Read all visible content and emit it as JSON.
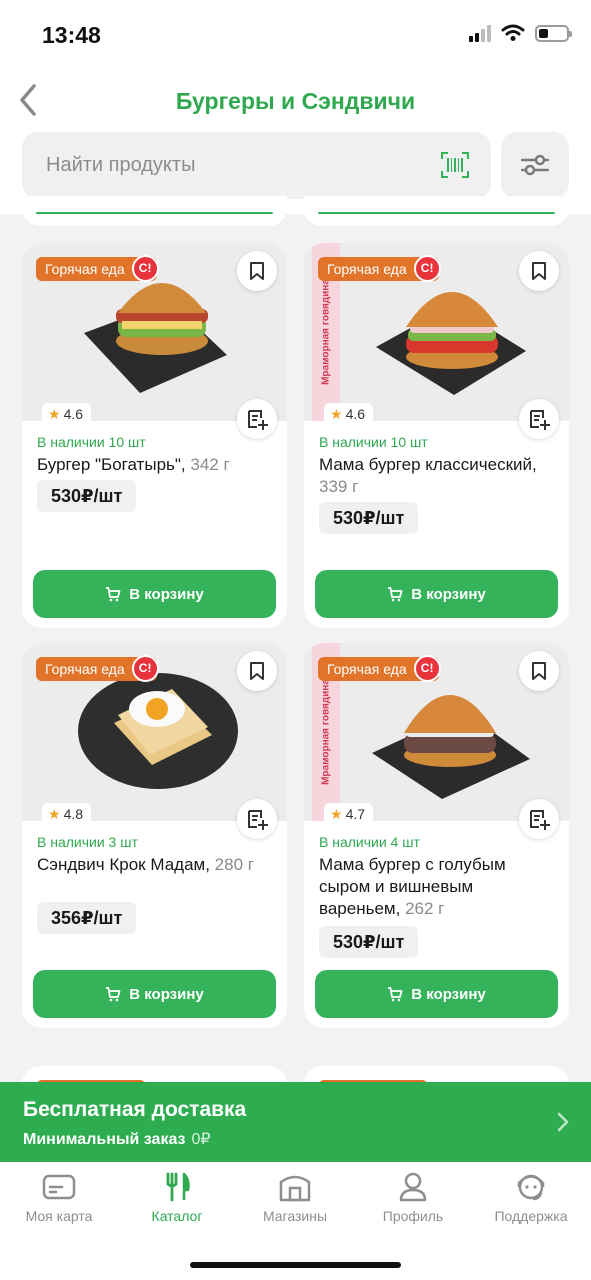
{
  "status_bar": {
    "time": "13:48"
  },
  "header": {
    "title": "Бургеры и Сэндвичи"
  },
  "search": {
    "placeholder": "Найти продукты"
  },
  "products": [
    {
      "tag": "Горячая еда",
      "promo": "",
      "rating": "4.6",
      "availability": "В наличии 10 шт",
      "name": "Бургер \"Богатырь\",",
      "weight": "342 г",
      "price": "530₽/шт",
      "button": "В корзину"
    },
    {
      "tag": "Горячая еда",
      "promo": "Мраморная говядина",
      "rating": "4.6",
      "availability": "В наличии 10 шт",
      "name": "Мама бургер классический,",
      "weight": "339 г",
      "price": "530₽/шт",
      "button": "В корзину"
    },
    {
      "tag": "Горячая еда",
      "promo": "",
      "rating": "4.8",
      "availability": "В наличии 3 шт",
      "name": "Сэндвич Крок Мадам,",
      "weight": "280 г",
      "price": "356₽/шт",
      "button": "В корзину"
    },
    {
      "tag": "Горячая еда",
      "promo": "Мраморная говядина",
      "rating": "4.7",
      "availability": "В наличии 4 шт",
      "name": "Мама бургер с голубым сыром и вишневым вареньем,",
      "weight": "262 г",
      "price": "530₽/шт",
      "button": "В корзину"
    }
  ],
  "delivery": {
    "title": "Бесплатная доставка",
    "subtitle": "Минимальный заказ",
    "amount": "0₽"
  },
  "tabbar": {
    "items": [
      {
        "label": "Моя карта",
        "icon": "card-icon"
      },
      {
        "label": "Каталог",
        "icon": "cutlery-icon"
      },
      {
        "label": "Магазины",
        "icon": "store-icon"
      },
      {
        "label": "Профиль",
        "icon": "profile-icon"
      },
      {
        "label": "Поддержка",
        "icon": "support-icon"
      }
    ],
    "active": "Каталог"
  },
  "colors": {
    "accent": "#2fa84f",
    "button": "#35b35b",
    "tag": "#e2742a",
    "promo": "#f7d5dc"
  }
}
